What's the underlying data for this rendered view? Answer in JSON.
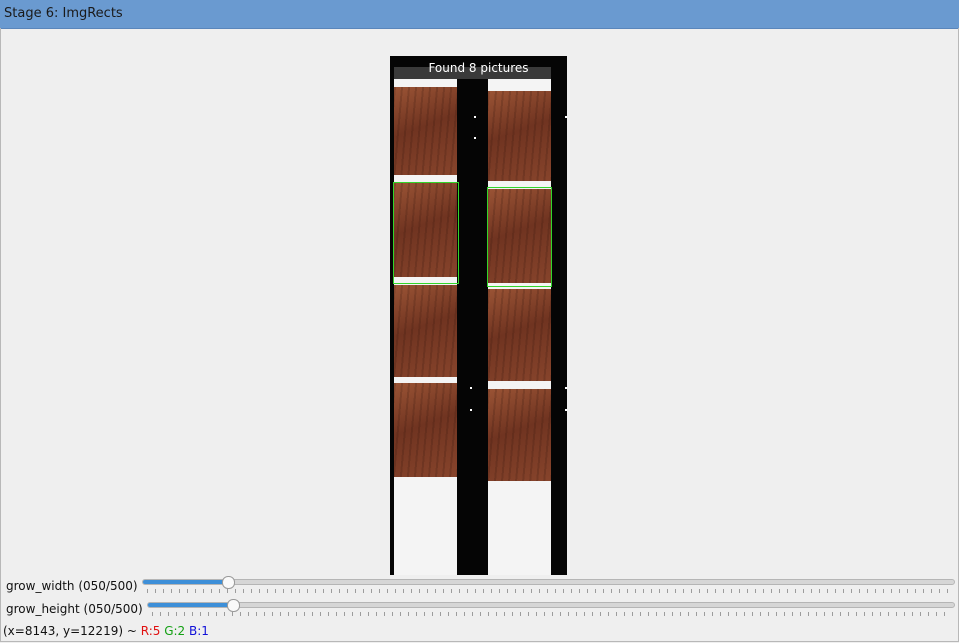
{
  "window": {
    "title": "Stage 6: ImgRects"
  },
  "image": {
    "caption": "Found 8 pictures"
  },
  "sliders": [
    {
      "label": "grow_width (050/500)",
      "value": 50,
      "max": 500
    },
    {
      "label": "grow_height (050/500)",
      "value": 50,
      "max": 500
    }
  ],
  "status": {
    "coords": "(x=8143, y=12219) ~",
    "r": "R:5",
    "g": "G:2",
    "b": "B:1",
    "colors": {
      "r": "#e01010",
      "g": "#13a013",
      "b": "#1010d8"
    }
  },
  "colors": {
    "titlebar": "#6a9ad0",
    "selection": "#33d62a",
    "slider_fill": "#3d8fd8"
  }
}
